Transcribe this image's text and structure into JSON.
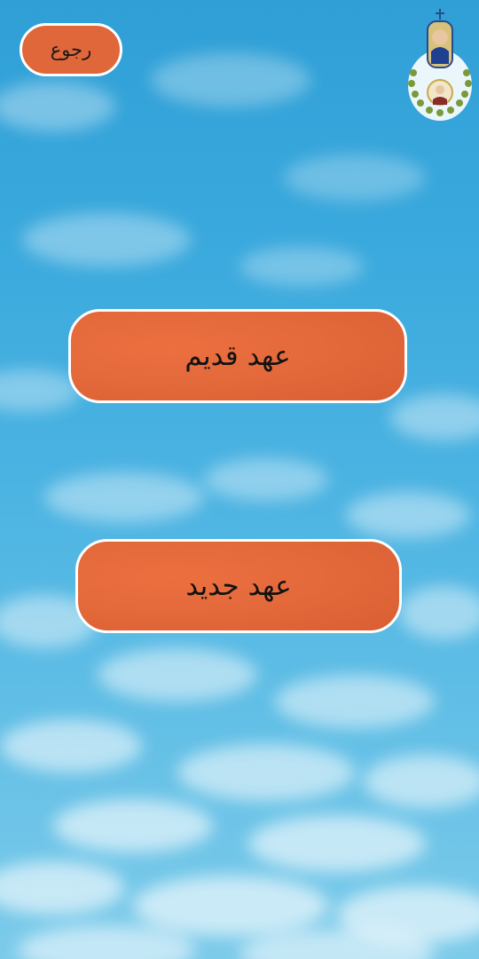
{
  "header": {
    "back_label": "رجوع",
    "logo_icon": "church-logo-icon"
  },
  "menu": {
    "old_testament_label": "عهد قديم",
    "new_testament_label": "عهد جديد"
  },
  "colors": {
    "button_fill": "#e2683a",
    "button_border": "#ffffff",
    "sky_top": "#2f9fd6",
    "sky_bottom": "#7ccbea"
  }
}
